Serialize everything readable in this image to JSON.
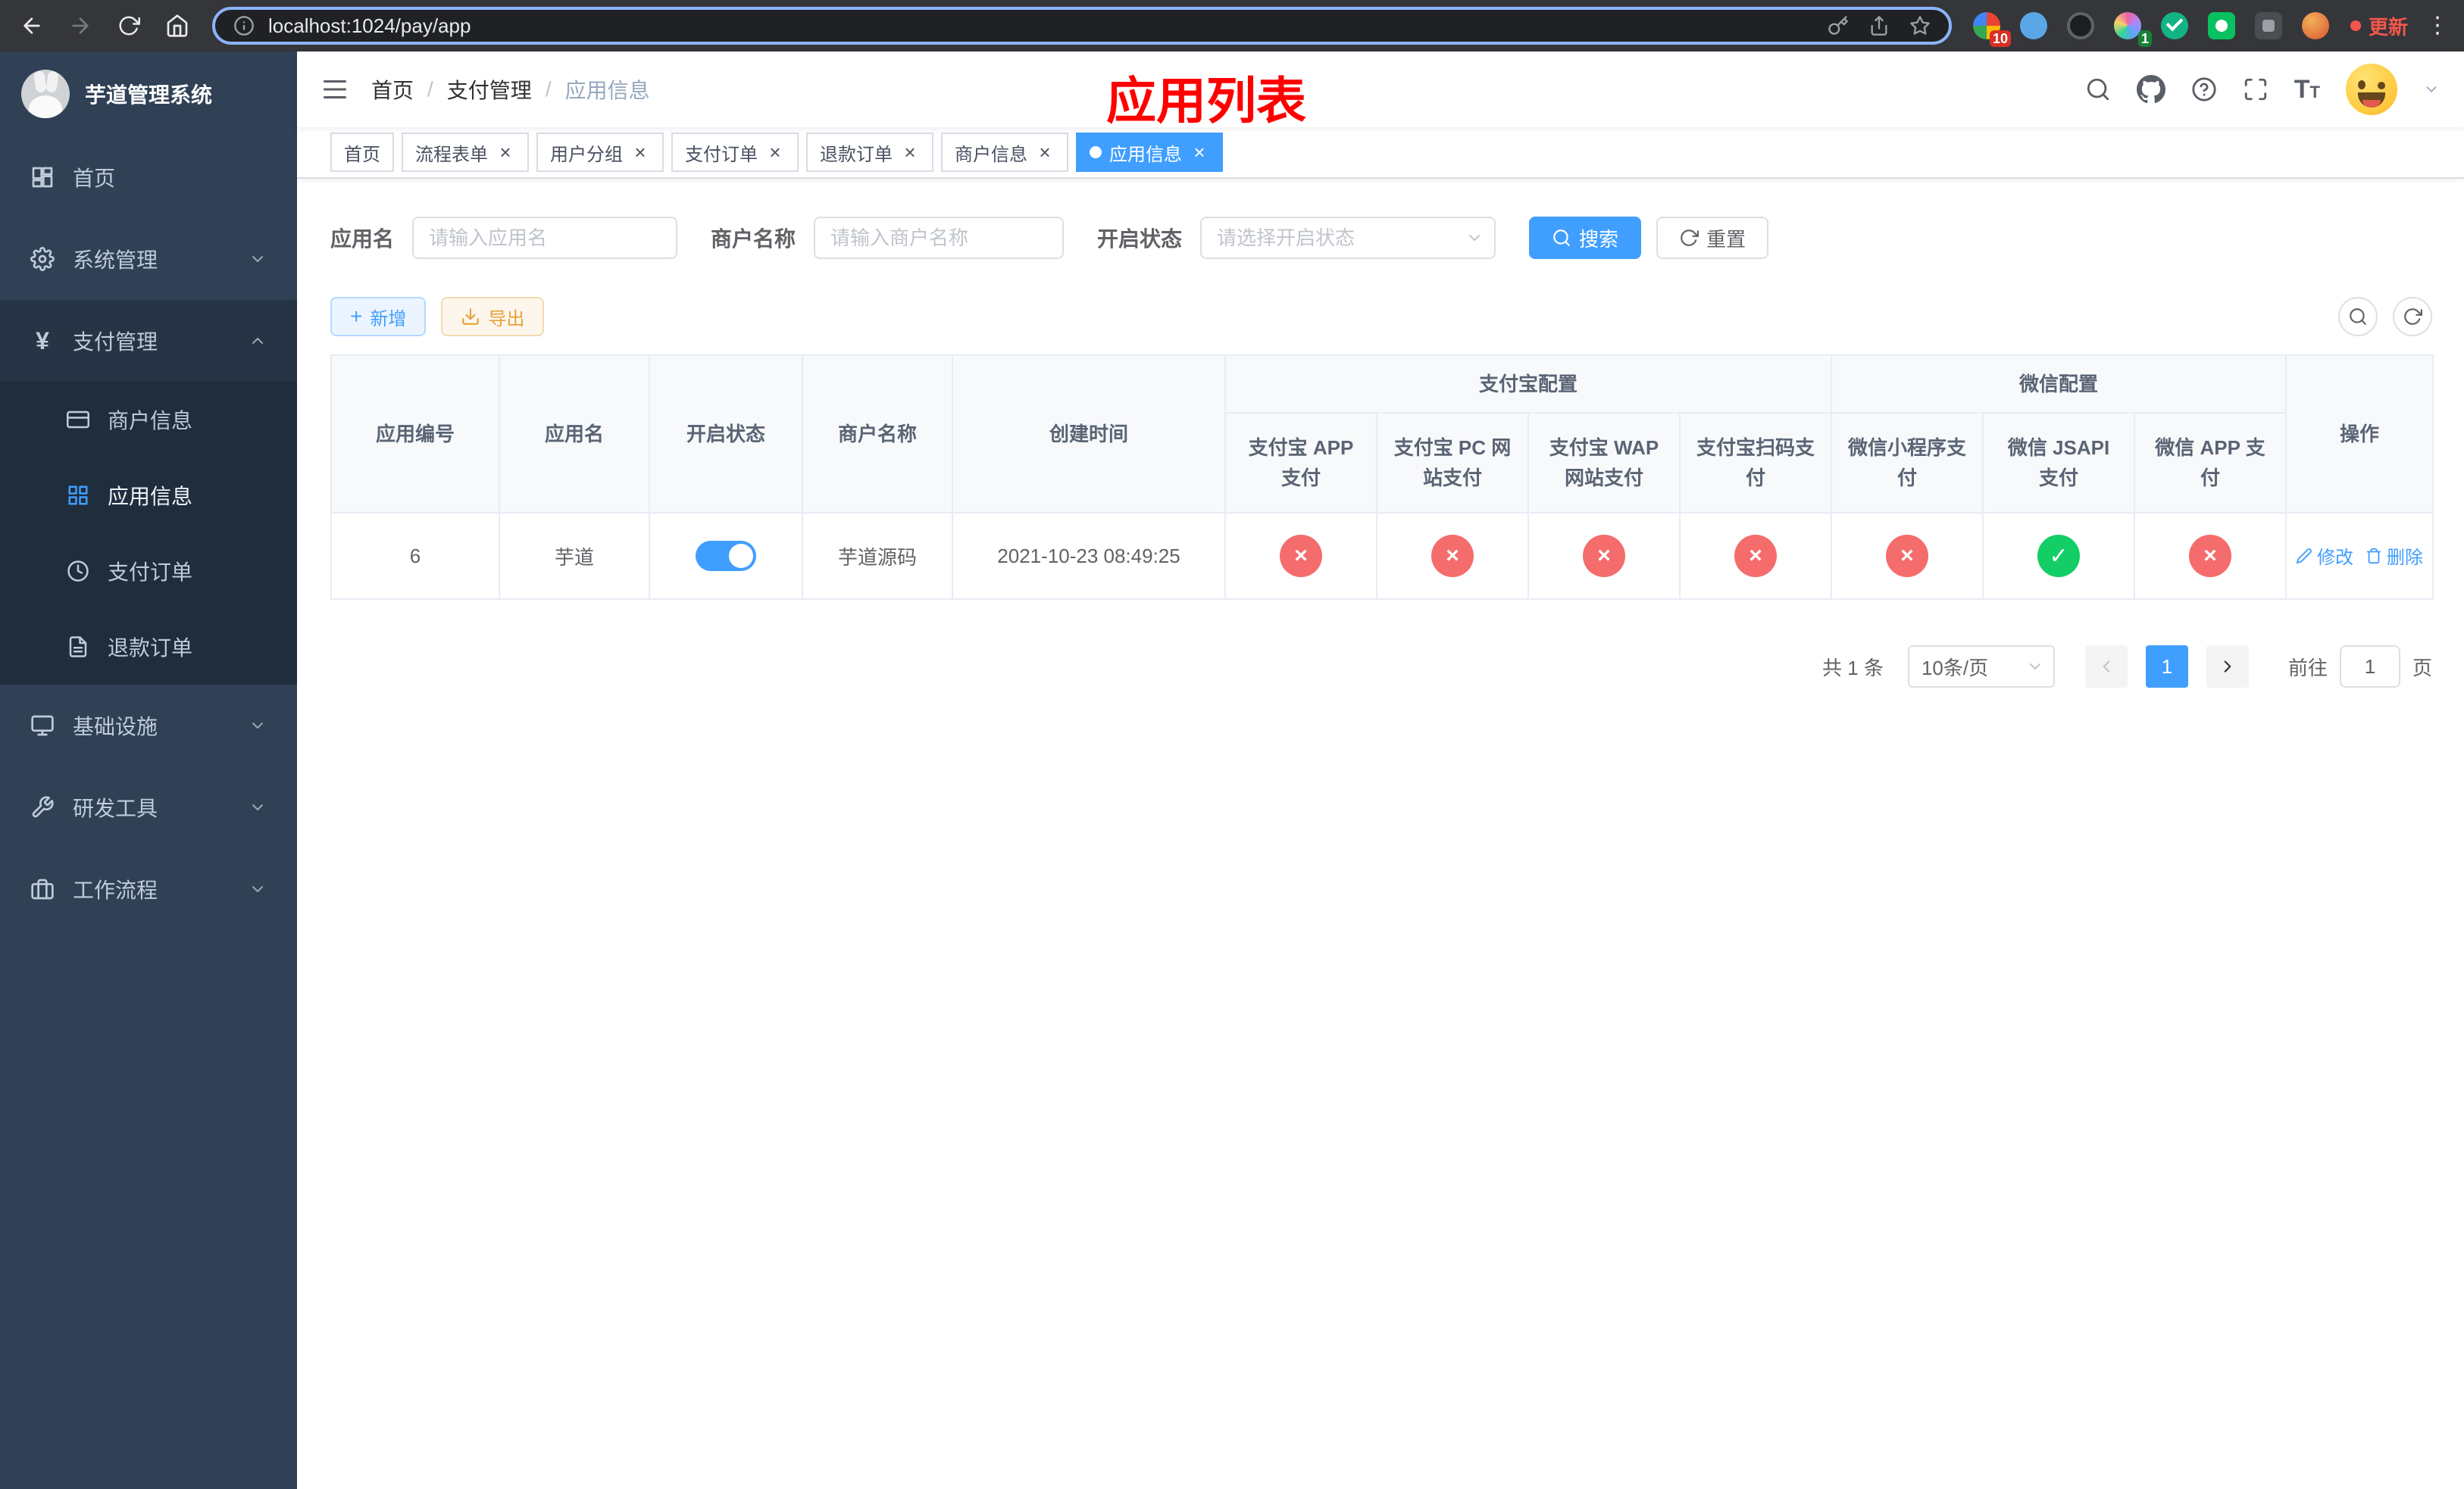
{
  "browser": {
    "url": "localhost:1024/pay/app",
    "update_label": "更新",
    "ext_badge_red": "10",
    "ext_badge_green": "1",
    "menu_dots": "⋮"
  },
  "sidebar": {
    "title": "芋道管理系统",
    "items": [
      {
        "label": "首页"
      },
      {
        "label": "系统管理"
      },
      {
        "label": "支付管理"
      },
      {
        "label": "商户信息"
      },
      {
        "label": "应用信息"
      },
      {
        "label": "支付订单"
      },
      {
        "label": "退款订单"
      },
      {
        "label": "基础设施"
      },
      {
        "label": "研发工具"
      },
      {
        "label": "工作流程"
      }
    ]
  },
  "header": {
    "breadcrumb": [
      {
        "label": "首页"
      },
      {
        "label": "支付管理"
      },
      {
        "label": "应用信息"
      }
    ],
    "separator": "/",
    "overlay_title": "应用列表"
  },
  "tabs": [
    {
      "label": "首页"
    },
    {
      "label": "流程表单"
    },
    {
      "label": "用户分组"
    },
    {
      "label": "支付订单"
    },
    {
      "label": "退款订单"
    },
    {
      "label": "商户信息"
    },
    {
      "label": "应用信息"
    }
  ],
  "filters": {
    "app_name": {
      "label": "应用名",
      "placeholder": "请输入应用名"
    },
    "merchant_name": {
      "label": "商户名称",
      "placeholder": "请输入商户名称"
    },
    "status": {
      "label": "开启状态",
      "placeholder": "请选择开启状态"
    },
    "search": "搜索",
    "reset": "重置"
  },
  "toolbar": {
    "add": "新增",
    "export": "导出"
  },
  "table": {
    "columns": {
      "id": "应用编号",
      "name": "应用名",
      "status": "开启状态",
      "merchant": "商户名称",
      "created": "创建时间",
      "actions": "操作"
    },
    "groups": {
      "alipay": "支付宝配置",
      "wechat": "微信配置"
    },
    "channel_columns": [
      "支付宝 APP 支付",
      "支付宝 PC 网站支付",
      "支付宝 WAP 网站支付",
      "支付宝扫码支付",
      "微信小程序支付",
      "微信 JSAPI 支付",
      "微信 APP 支付"
    ],
    "rows": [
      {
        "id": "6",
        "name": "芋道",
        "status": true,
        "merchant": "芋道源码",
        "created": "2021-10-23 08:49:25",
        "channels": [
          false,
          false,
          false,
          false,
          false,
          true,
          false
        ],
        "edit": "修改",
        "delete": "删除"
      }
    ]
  },
  "pagination": {
    "total": "共 1 条",
    "page_size": "10条/页",
    "page": "1",
    "goto_label": "前往",
    "goto_value": "1",
    "page_unit": "页"
  },
  "icons": {
    "close": "×",
    "check": "✓",
    "cross": "×",
    "plus": "+",
    "yen": "¥",
    "text_size": "T"
  },
  "colors": {
    "primary": "#409eff",
    "success": "#13ce66",
    "danger": "#f56c6c",
    "warning": "#e6a23c",
    "annotation_red": "#ff0000",
    "sidebar_bg": "#304156",
    "sidebar_sub_bg": "#1f2d3d"
  }
}
